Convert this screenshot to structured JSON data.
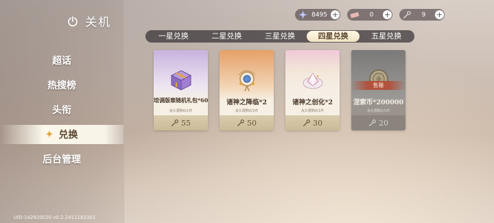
{
  "sidebar": {
    "shutdown_label": "关机",
    "items": [
      {
        "label": "超话"
      },
      {
        "label": "热搜榜"
      },
      {
        "label": "头衔"
      },
      {
        "label": "兑换"
      },
      {
        "label": "后台管理"
      }
    ],
    "active_index": 3,
    "uid_text": "UID:142920020  v0.2.2411182301"
  },
  "currencies": [
    {
      "icon": "crystal-icon",
      "value": "8495"
    },
    {
      "icon": "ticket-icon",
      "value": "0"
    },
    {
      "icon": "key-icon",
      "value": "9"
    }
  ],
  "plus_label": "+",
  "tabs": [
    {
      "label": "一星兑换"
    },
    {
      "label": "二星兑换"
    },
    {
      "label": "三星兑换"
    },
    {
      "label": "四星兑换"
    },
    {
      "label": "五星兑换"
    }
  ],
  "active_tab": 3,
  "cards": [
    {
      "name": "培调版章随机礼包*60",
      "limit": "永久限购0/1件",
      "price": "55",
      "theme": "purple",
      "icon": "gift-box-icon",
      "sold_out": false
    },
    {
      "name": "诸神之降临*2",
      "limit": "永久限购0/1件",
      "price": "50",
      "theme": "orange",
      "icon": "ornament-icon",
      "sold_out": false
    },
    {
      "name": "诸神之创化*2",
      "limit": "永久限购0/1件",
      "price": "30",
      "theme": "rainbow",
      "icon": "crystal-stone-icon",
      "sold_out": false
    },
    {
      "name": "涅索币*200000",
      "limit": "永久限购1/1件",
      "price": "20",
      "theme": "grey",
      "icon": "coin-icon",
      "sold_out": true,
      "sold_out_label": "售罄"
    }
  ],
  "colors": {
    "accent_gold": "#d9a440",
    "soldout_band": "#b0523e",
    "tab_bar": "#2d2730"
  }
}
